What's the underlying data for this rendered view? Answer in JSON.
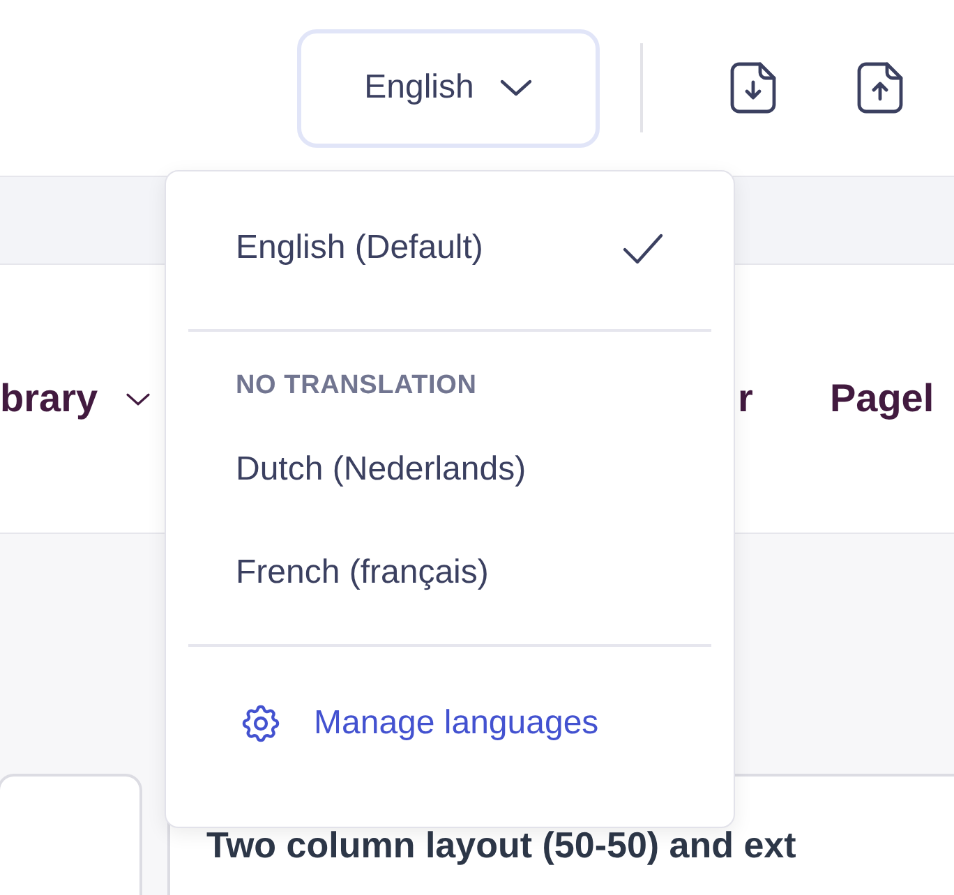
{
  "toolbar": {
    "language_button": {
      "label": "English",
      "expanded": true
    }
  },
  "nav_items": [
    {
      "label": "brary",
      "kind": "dropdown"
    },
    {
      "label": "r",
      "kind": "link"
    },
    {
      "label": "Pagel",
      "kind": "link"
    }
  ],
  "content_card": {
    "title": "Two column layout (50-50) and ext"
  },
  "language_menu": {
    "current": [
      {
        "label": "English (Default)",
        "selected": true
      }
    ],
    "section_header": "NO TRANSLATION",
    "untranslated": [
      {
        "label": "Dutch (Nederlands)",
        "selected": false
      },
      {
        "label": "French (français)",
        "selected": false
      }
    ],
    "manage_link": "Manage languages"
  }
}
